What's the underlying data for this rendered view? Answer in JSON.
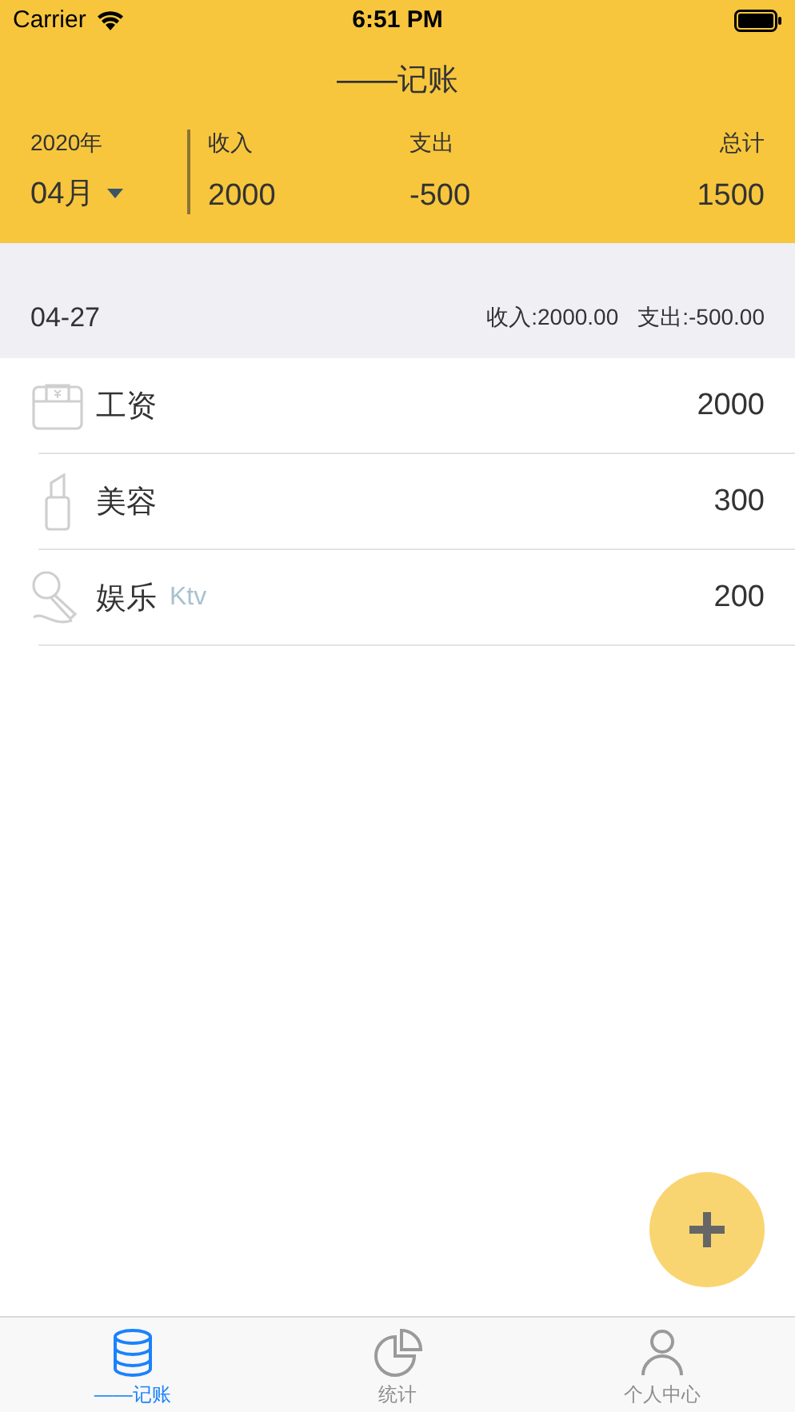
{
  "status_bar": {
    "carrier": "Carrier",
    "time": "6:51 PM"
  },
  "nav": {
    "title": "——记账"
  },
  "summary": {
    "year": "2020年",
    "month": "04月",
    "columns": [
      {
        "label": "收入",
        "value": "2000"
      },
      {
        "label": "支出",
        "value": "-500"
      },
      {
        "label": "总计",
        "value": "1500"
      }
    ]
  },
  "day": {
    "date": "04-27",
    "income": "收入:2000.00",
    "expense": "支出:-500.00"
  },
  "entries": [
    {
      "kind": "wallet",
      "name": "工资",
      "amount": "2000"
    },
    {
      "kind": "lipstick",
      "name": "美容",
      "amount": "300"
    },
    {
      "kind": "microphone",
      "name": "娱乐",
      "note": "Ktv",
      "amount": "200"
    }
  ],
  "tabs": [
    {
      "kind": "database",
      "label": "——记账",
      "selected": true
    },
    {
      "kind": "pie",
      "label": "统计",
      "selected": false
    },
    {
      "kind": "person",
      "label": "个人中心",
      "selected": false
    }
  ]
}
